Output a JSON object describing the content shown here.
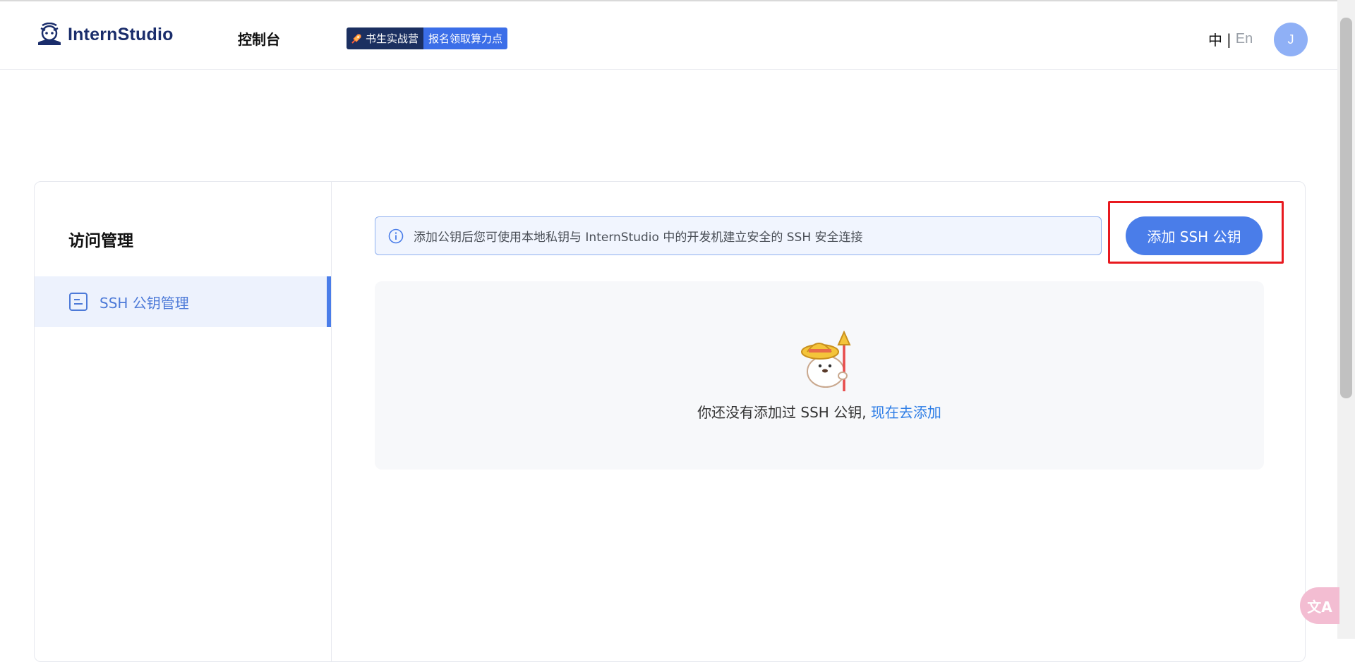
{
  "header": {
    "brand": "InternStudio",
    "nav_console": "控制台",
    "promo_left": "书生实战营",
    "promo_right": "报名领取算力点",
    "lang_zh": "中",
    "lang_sep": "|",
    "lang_en": "En",
    "avatar_initial": "J"
  },
  "sidebar": {
    "title": "访问管理",
    "items": [
      {
        "label": "SSH 公钥管理",
        "icon": "document-icon",
        "active": true
      }
    ]
  },
  "main": {
    "alert_text": "添加公钥后您可使用本地私钥与 InternStudio 中的开发机建立安全的 SSH 安全连接",
    "add_button_label": "添加 SSH 公钥",
    "empty_text": "你还没有添加过 SSH 公钥, ",
    "empty_link": "现在去添加"
  },
  "floating": {
    "translate_label": "文A"
  },
  "colors": {
    "primary": "#4a7de9",
    "highlight": "#e8191f",
    "brand": "#1a2d6b"
  }
}
